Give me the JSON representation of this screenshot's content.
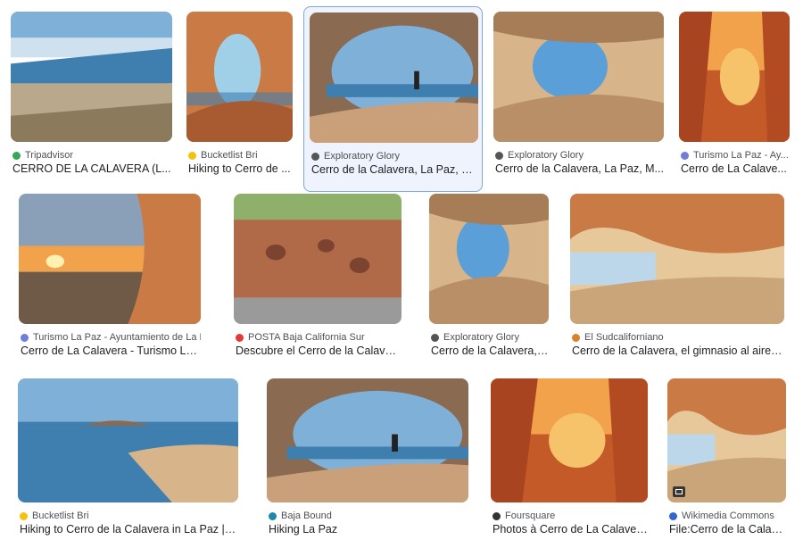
{
  "results": [
    {
      "source": "Tripadvisor",
      "title": "CERRO DE LA CALAVERA (L...",
      "icon": "tripadvisor-icon",
      "icon_color": "#34a853",
      "selected": false
    },
    {
      "source": "Bucketlist Bri",
      "title": "Hiking to Cerro de ...",
      "icon": "bulb-icon",
      "icon_color": "#f4c20d",
      "selected": false
    },
    {
      "source": "Exploratory Glory",
      "title": "Cerro de la Calavera, La Paz, M...",
      "icon": "site-icon",
      "icon_color": "#555555",
      "selected": true
    },
    {
      "source": "Exploratory Glory",
      "title": "Cerro de la Calavera, La Paz, M...",
      "icon": "site-icon",
      "icon_color": "#555555",
      "selected": false
    },
    {
      "source": "Turismo La Paz - Ay...",
      "title": "Cerro de La Calave...",
      "icon": "globe-icon",
      "icon_color": "#6f7ddb",
      "selected": false
    },
    {
      "source": "Turismo La Paz - Ayuntamiento de La Paz",
      "title": "Cerro de La Calavera - Turismo La Paz",
      "icon": "globe-icon",
      "icon_color": "#6f7ddb",
      "selected": false
    },
    {
      "source": "POSTA Baja California Sur",
      "title": "Descubre el Cerro de la Calavera e...",
      "icon": "posta-icon",
      "icon_color": "#e53935",
      "selected": false
    },
    {
      "source": "Exploratory Glory",
      "title": "Cerro de la Calavera, L...",
      "icon": "site-icon",
      "icon_color": "#555555",
      "selected": false
    },
    {
      "source": "El Sudcaliforniano",
      "title": "Cerro de la Calavera, el gimnasio al aire lib...",
      "icon": "person-icon",
      "icon_color": "#d9822b",
      "selected": false
    },
    {
      "source": "Bucketlist Bri",
      "title": "Hiking to Cerro de la Calavera in La Paz | Buc...",
      "icon": "bulb-icon",
      "icon_color": "#f4c20d",
      "selected": false
    },
    {
      "source": "Baja Bound",
      "title": "Hiking La Paz",
      "icon": "bajabound-icon",
      "icon_color": "#1e88a8",
      "selected": false
    },
    {
      "source": "Foursquare",
      "title": "Photos à Cerro de La Calaver...",
      "icon": "foursquare-icon",
      "icon_color": "#333333",
      "selected": false
    },
    {
      "source": "Wikimedia Commons",
      "title": "File:Cerro de la Calave...",
      "icon": "wikimedia-icon",
      "icon_color": "#3366cc",
      "selected": false
    }
  ],
  "colors": {
    "sky": "#7fb0d8",
    "rock": "#c97a45",
    "sand": "#d8b48a",
    "sea": "#3f7fb0",
    "sunset": "#f1a24a"
  }
}
